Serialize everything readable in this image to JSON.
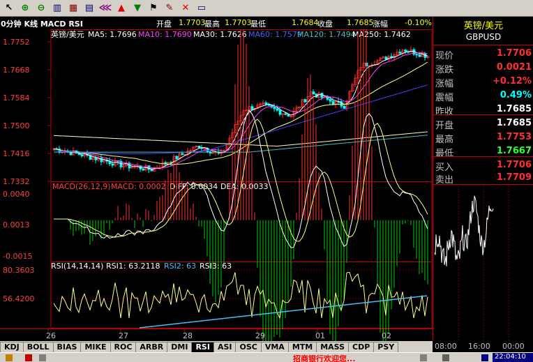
{
  "toolbar": {
    "icons": [
      "cursor-icon",
      "zoom-in-icon",
      "zoom-out-icon",
      "bar-chart-icon",
      "candle-chart-icon",
      "grid-icon",
      "fan-icon",
      "up-arrow-icon",
      "down-arrow-icon",
      "flag-icon",
      "eraser-icon",
      "close-icon",
      "monitor-icon"
    ]
  },
  "infoline": {
    "title": "0分钟 K线 MACD RSI",
    "open_label": "开盘",
    "open_value": "1.7703",
    "high_label": "最高",
    "high_value": "1.7703",
    "low_label": "最低",
    "low_value": "1.7684",
    "close_label": "收盘",
    "close_value": "1.7685",
    "change_label": "涨幅",
    "change_value": "-0.10%"
  },
  "kline": {
    "legend_name": "英镑/美元",
    "ma5": "MA5: 1.7696",
    "ma10": "MA10: 1.7690",
    "ma30": "MA30: 1.7626",
    "ma60": "MA60: 1.7579",
    "ma120": "MA120: 1.7494",
    "ma250": "MA250: 1.7462",
    "yticks": [
      "1.7752",
      "1.7668",
      "1.7584",
      "1.7500",
      "1.7416",
      "1.7332"
    ]
  },
  "macd": {
    "title": "MACD(26,12,9)",
    "macd": "MACD: 0.0002",
    "diff": "DIFF: 0.0034",
    "dea": "DEA: 0.0033",
    "yticks": [
      "0.0040",
      "0.0013",
      "-0.0015"
    ]
  },
  "rsi": {
    "title": "RSI(14,14,14)",
    "rsi1": "RSI1: 63.2118",
    "rsi2": "RSI2: 63",
    "rsi3": "RSI3: 63",
    "yticks": [
      "80.3603",
      "56.4200"
    ]
  },
  "xaxis": [
    "26",
    "27",
    "28",
    "29",
    "01",
    "02"
  ],
  "panel": {
    "title": "英镑/美元",
    "symbol": "GBPUSD",
    "rows": [
      {
        "label": "现价",
        "value": "1.7706",
        "color": "#ff3030"
      },
      {
        "label": "涨跌",
        "value": "0.0021",
        "color": "#ff3030"
      },
      {
        "label": "涨幅",
        "value": "+0.12%",
        "color": "#ff3030"
      },
      {
        "label": "震幅",
        "value": "0.49%",
        "color": "#00ffff"
      },
      {
        "label": "昨收",
        "value": "1.7685",
        "color": "#ffffff"
      },
      {
        "label": "开盘",
        "value": "1.7685",
        "color": "#ffffff"
      },
      {
        "label": "最高",
        "value": "1.7753",
        "color": "#ff3030"
      },
      {
        "label": "最低",
        "value": "1.7667",
        "color": "#30ff30"
      },
      {
        "label": "买入",
        "value": "1.7706",
        "color": "#ff3030"
      },
      {
        "label": "卖出",
        "value": "1.7709",
        "color": "#ff3030"
      }
    ],
    "time_labels": [
      "08:00",
      "16:00",
      "00:00"
    ]
  },
  "tabs": [
    "KDJ",
    "BOLL",
    "BIAS",
    "MIKE",
    "ROC",
    "ARBR",
    "DMI",
    "RSI",
    "ASI",
    "OSC",
    "VMA",
    "MTM",
    "MASS",
    "CDP",
    "PSY"
  ],
  "active_tab": "RSI",
  "status": {
    "ticker": "招商银行欢迎您...",
    "clock": "22:04:10"
  },
  "colors": {
    "up": "#ff3030",
    "down": "#00ffff",
    "ma5": "#ffffff",
    "ma10": "#ff40ff",
    "ma30": "#ffff80",
    "ma60": "#4040ff",
    "ma120": "#40c0c0",
    "ma250": "#ffffc0",
    "grid": "#c00000"
  }
}
